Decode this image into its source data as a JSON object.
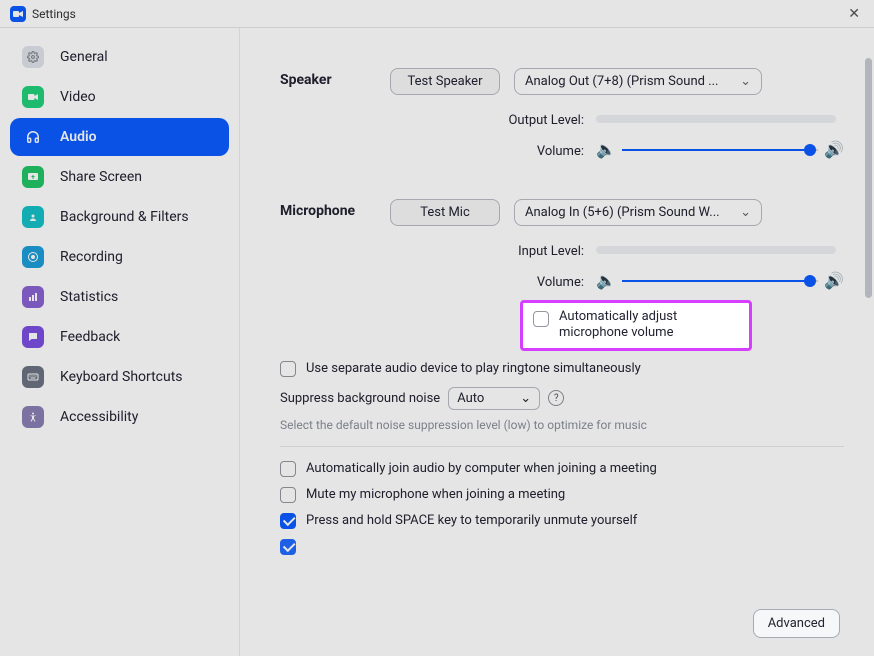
{
  "titlebar": {
    "title": "Settings"
  },
  "sidebar": {
    "items": [
      {
        "label": "General"
      },
      {
        "label": "Video"
      },
      {
        "label": "Audio"
      },
      {
        "label": "Share Screen"
      },
      {
        "label": "Background & Filters"
      },
      {
        "label": "Recording"
      },
      {
        "label": "Statistics"
      },
      {
        "label": "Feedback"
      },
      {
        "label": "Keyboard Shortcuts"
      },
      {
        "label": "Accessibility"
      }
    ]
  },
  "speaker": {
    "title": "Speaker",
    "test_label": "Test Speaker",
    "device": "Analog Out (7+8) (Prism Sound ...",
    "output_level_label": "Output Level:",
    "volume_label": "Volume:",
    "volume_pct": 96
  },
  "microphone": {
    "title": "Microphone",
    "test_label": "Test Mic",
    "device": "Analog In (5+6) (Prism Sound W...",
    "input_level_label": "Input Level:",
    "volume_label": "Volume:",
    "volume_pct": 96,
    "auto_adjust_label": "Automatically adjust microphone volume",
    "auto_adjust_checked": false
  },
  "ringtone": {
    "separate_device_label": "Use separate audio device to play ringtone simultaneously",
    "separate_device_checked": false
  },
  "noise": {
    "suppress_label": "Suppress background noise",
    "mode": "Auto",
    "hint": "Select the default noise suppression level (low) to optimize for music"
  },
  "options": {
    "auto_join_label": "Automatically join audio by computer when joining a meeting",
    "auto_join_checked": false,
    "mute_on_join_label": "Mute my microphone when joining a meeting",
    "mute_on_join_checked": false,
    "space_unmute_label": "Press and hold SPACE key to temporarily unmute yourself",
    "space_unmute_checked": true
  },
  "buttons": {
    "advanced": "Advanced"
  }
}
